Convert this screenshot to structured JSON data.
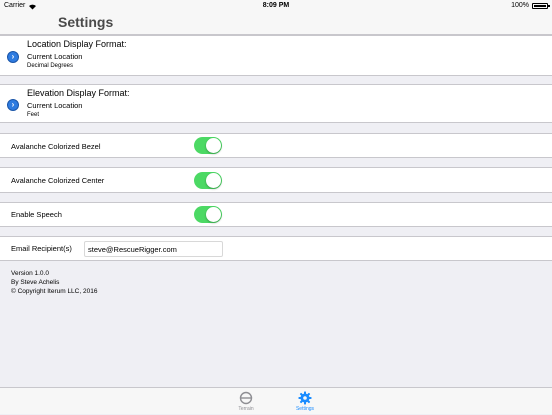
{
  "status_bar": {
    "carrier": "Carrier",
    "time": "8:09 PM",
    "battery": "100%",
    "battery_level": 1.0
  },
  "nav": {
    "title": "Settings"
  },
  "location_format": {
    "title": "Location Display Format:",
    "value": "Current Location",
    "detail": "Decimal Degrees"
  },
  "elevation_format": {
    "title": "Elevation Display Format:",
    "value": "Current Location",
    "detail": "Feet"
  },
  "toggles": {
    "bezel": {
      "label": "Avalanche Colorized Bezel",
      "on": true
    },
    "center": {
      "label": "Avalanche Colorized Center",
      "on": true
    },
    "speech": {
      "label": "Enable Speech",
      "on": true
    }
  },
  "email": {
    "label": "Email Recipient(s)",
    "value": "steve@RescueRigger.com"
  },
  "footer": {
    "version": "Version 1.0.0",
    "author": "By Steve Achelis",
    "copyright": "© Copyright Iterum LLC, 2016"
  },
  "tabs": {
    "terrain": {
      "label": "Terrain",
      "icon": "terrain-icon",
      "color": "#8e8e93"
    },
    "settings": {
      "label": "Settings",
      "icon": "gear-icon",
      "color": "#1a8cff",
      "selected": true
    }
  },
  "colors": {
    "accent": "#1a8cff",
    "toggle_on": "#4cd964",
    "info": "#2e7be0"
  }
}
